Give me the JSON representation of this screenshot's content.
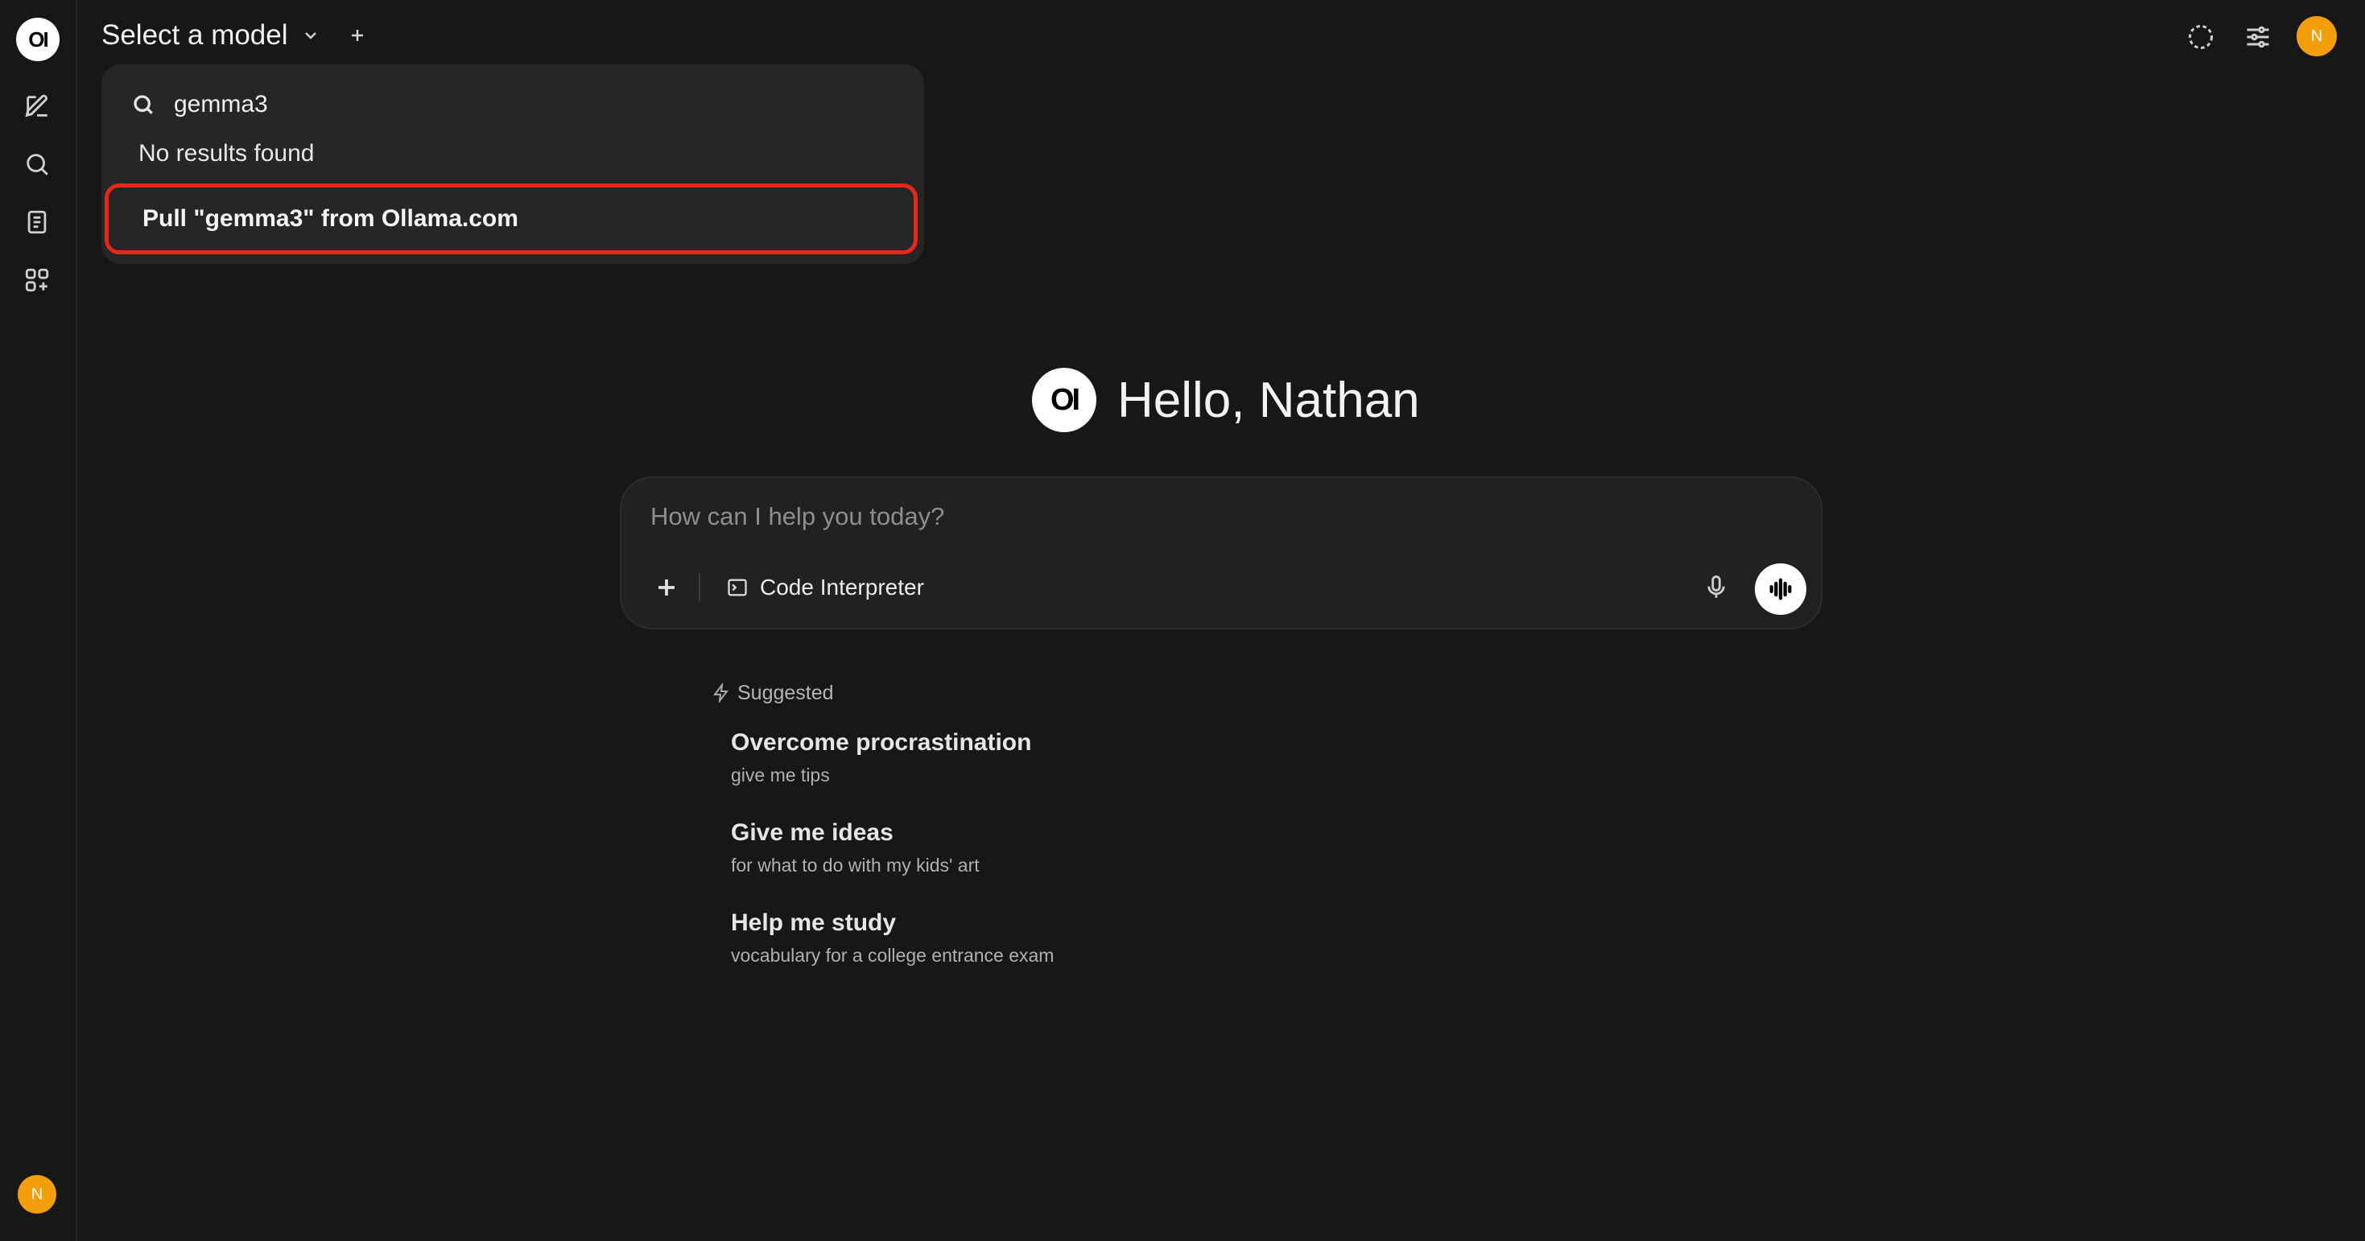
{
  "sidebar": {
    "logo_text": "OI",
    "icons": [
      "new-chat-icon",
      "search-icon",
      "notes-icon",
      "workspace-icon"
    ],
    "user_initial": "N"
  },
  "header": {
    "model_selector_label": "Select a model",
    "user_initial": "N",
    "icons": [
      "temporary-chat-icon",
      "controls-icon"
    ]
  },
  "dropdown": {
    "search_value": "gemma3",
    "no_results_text": "No results found",
    "pull_label": "Pull \"gemma3\" from Ollama.com",
    "highlight_color": "#e8271a"
  },
  "main": {
    "logo_text": "OI",
    "greeting": "Hello, Nathan",
    "input_placeholder": "How can I help you today?",
    "tool_label": "Code Interpreter",
    "suggested_label": "Suggested",
    "suggestions": [
      {
        "title": "Overcome procrastination",
        "subtitle": "give me tips"
      },
      {
        "title": "Give me ideas",
        "subtitle": "for what to do with my kids' art"
      },
      {
        "title": "Help me study",
        "subtitle": "vocabulary for a college entrance exam"
      }
    ]
  },
  "colors": {
    "background": "#171717",
    "avatar": "#f59e0b",
    "dropdown_bg": "#262626"
  }
}
